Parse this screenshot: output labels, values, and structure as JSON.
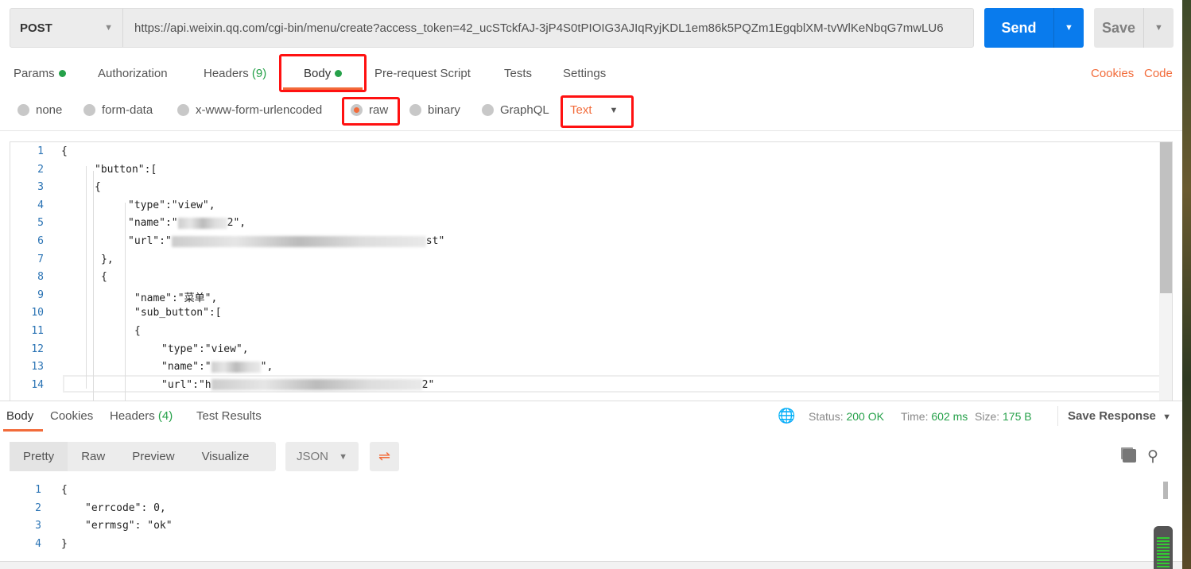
{
  "request": {
    "method": "POST",
    "url": "https://api.weixin.qq.com/cgi-bin/menu/create?access_token=42_ucSTckfAJ-3jP4S0tPIOIG3AJIqRyjKDL1em86k5PQZm1EgqblXM-tvWlKeNbqG7mwLU6",
    "send": "Send",
    "save": "Save"
  },
  "tabs": {
    "params": "Params",
    "authorization": "Authorization",
    "headers": "Headers",
    "headers_count": "(9)",
    "body": "Body",
    "prerequest": "Pre-request Script",
    "tests": "Tests",
    "settings": "Settings",
    "cookies": "Cookies",
    "code": "Code"
  },
  "body_types": {
    "none": "none",
    "form_data": "form-data",
    "urlencoded": "x-www-form-urlencoded",
    "raw": "raw",
    "binary": "binary",
    "graphql": "GraphQL",
    "format": "Text",
    "selected": "raw"
  },
  "editor": {
    "lines": [
      {
        "n": "1",
        "indent": 0,
        "text": "{"
      },
      {
        "n": "2",
        "indent": 42,
        "text": "\"button\":["
      },
      {
        "n": "3",
        "indent": 42,
        "text": "{"
      },
      {
        "n": "4",
        "indent": 84,
        "text": "\"type\":\"view\","
      },
      {
        "n": "5",
        "indent": 84,
        "text": "\"name\":\"",
        "blur": 62,
        "tail": "2\","
      },
      {
        "n": "6",
        "indent": 84,
        "text": "\"url\":\"",
        "blur": 320,
        "tail": "st\""
      },
      {
        "n": "7",
        "indent": 50,
        "text": "},"
      },
      {
        "n": "8",
        "indent": 50,
        "text": "{"
      },
      {
        "n": "9",
        "indent": 92,
        "text": "\"name\":\"菜单\","
      },
      {
        "n": "10",
        "indent": 92,
        "text": "\"sub_button\":["
      },
      {
        "n": "11",
        "indent": 92,
        "text": "{"
      },
      {
        "n": "12",
        "indent": 126,
        "text": "\"type\":\"view\","
      },
      {
        "n": "13",
        "indent": 126,
        "text": "\"name\":\"",
        "blur": 62,
        "tail": "\","
      },
      {
        "n": "14",
        "indent": 126,
        "text": "\"url\":\"h",
        "blur": 265,
        "tail": "2\""
      }
    ]
  },
  "response": {
    "tabs": {
      "body": "Body",
      "cookies": "Cookies",
      "headers": "Headers",
      "headers_count": "(4)",
      "tests": "Test Results"
    },
    "status_label": "Status:",
    "status": "200 OK",
    "time_label": "Time:",
    "time": "602 ms",
    "size_label": "Size:",
    "size": "175 B",
    "save_response": "Save Response",
    "views": [
      "Pretty",
      "Raw",
      "Preview",
      "Visualize"
    ],
    "format": "JSON",
    "lines": [
      {
        "n": "1",
        "indent": 0,
        "text": "{"
      },
      {
        "n": "2",
        "indent": 30,
        "text": "\"errcode\": 0,"
      },
      {
        "n": "3",
        "indent": 30,
        "text": "\"errmsg\": \"ok\""
      },
      {
        "n": "4",
        "indent": 0,
        "text": "}"
      }
    ]
  },
  "colors": {
    "accent": "#f26b3a",
    "send": "#097bed",
    "success": "#26a14a",
    "highlight": "#ff1111"
  }
}
